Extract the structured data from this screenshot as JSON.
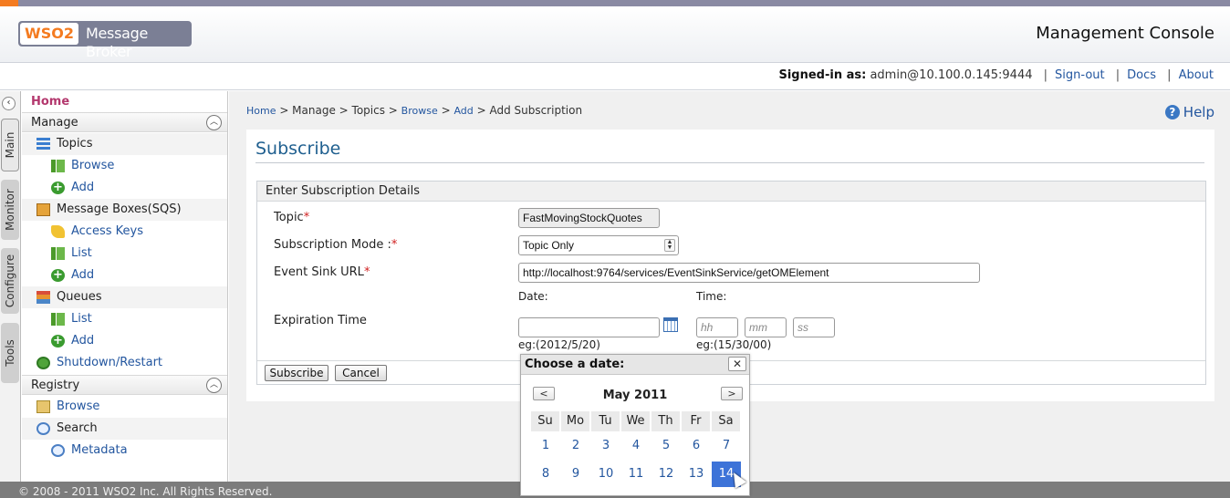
{
  "header": {
    "logo_brand": "WSO2",
    "logo_product": "Message Broker",
    "console_title": "Management Console"
  },
  "userbar": {
    "signed_in_label": "Signed-in as:",
    "user": "admin@10.100.0.145:9444",
    "sign_out": "Sign-out",
    "docs": "Docs",
    "about": "About"
  },
  "vtabs": [
    "Main",
    "Monitor",
    "Configure",
    "Tools"
  ],
  "menu": {
    "home": "Home",
    "manage": "Manage",
    "topics": "Topics",
    "topics_browse": "Browse",
    "topics_add": "Add",
    "message_boxes": "Message Boxes(SQS)",
    "access_keys": "Access Keys",
    "mb_list": "List",
    "mb_add": "Add",
    "queues": "Queues",
    "queues_list": "List",
    "queues_add": "Add",
    "shutdown": "Shutdown/Restart",
    "registry": "Registry",
    "reg_browse": "Browse",
    "reg_search": "Search",
    "reg_metadata": "Metadata"
  },
  "breadcrumb": {
    "home": "Home",
    "manage": "> Manage > Topics >",
    "browse": "Browse",
    "sep": ">",
    "add": "Add",
    "current": "> Add Subscription"
  },
  "help": "Help",
  "panel": {
    "title": "Subscribe",
    "section_title": "Enter Subscription Details",
    "topic_label": "Topic",
    "topic_value": "FastMovingStockQuotes",
    "mode_label": "Subscription Mode :",
    "mode_value": "Topic Only",
    "sink_label": "Event Sink URL",
    "sink_value": "http://localhost:9764/services/EventSinkService/getOMElement",
    "date_label": "Date:",
    "time_label": "Time:",
    "expiration_label": "Expiration Time",
    "hh_placeholder": "hh",
    "mm_placeholder": "mm",
    "ss_placeholder": "ss",
    "date_hint": "eg:(2012/5/20)",
    "time_hint": "eg:(15/30/00)",
    "subscribe_button": "Subscribe",
    "cancel_button": "Cancel",
    "required_mark": "*"
  },
  "datepicker": {
    "title": "Choose a date:",
    "close": "✕",
    "prev": "<",
    "next": ">",
    "month": "May 2011",
    "weekdays": [
      "Su",
      "Mo",
      "Tu",
      "We",
      "Th",
      "Fr",
      "Sa"
    ],
    "week1": [
      "1",
      "2",
      "3",
      "4",
      "5",
      "6",
      "7"
    ],
    "week2": [
      "8",
      "9",
      "10",
      "11",
      "12",
      "13",
      "14"
    ],
    "selected_day": "14"
  },
  "footer": "© 2008 - 2011 WSO2 Inc. All Rights Reserved.",
  "colors": {
    "accent": "#23569f",
    "home": "#b3376d",
    "selected_day": "#3d73d8",
    "brand_orange": "#f47b20"
  }
}
